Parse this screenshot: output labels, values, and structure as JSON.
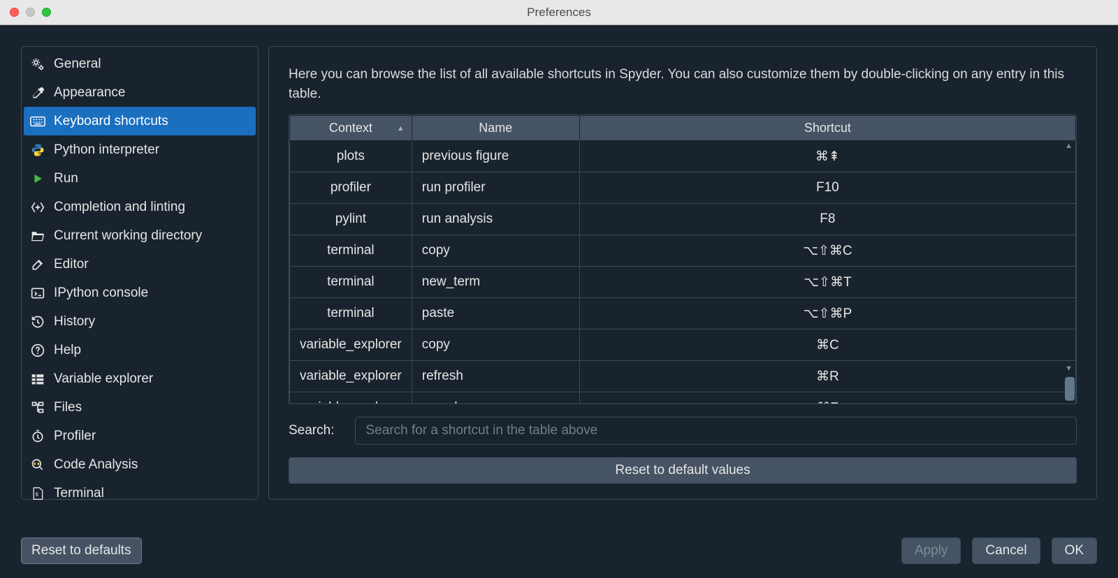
{
  "window": {
    "title": "Preferences"
  },
  "sidebar": {
    "items": [
      {
        "label": "General"
      },
      {
        "label": "Appearance"
      },
      {
        "label": "Keyboard shortcuts"
      },
      {
        "label": "Python interpreter"
      },
      {
        "label": "Run"
      },
      {
        "label": "Completion and linting"
      },
      {
        "label": "Current working directory"
      },
      {
        "label": "Editor"
      },
      {
        "label": "IPython console"
      },
      {
        "label": "History"
      },
      {
        "label": "Help"
      },
      {
        "label": "Variable explorer"
      },
      {
        "label": "Files"
      },
      {
        "label": "Profiler"
      },
      {
        "label": "Code Analysis"
      },
      {
        "label": "Terminal"
      }
    ],
    "selected_index": 2
  },
  "content": {
    "intro": "Here you can browse the list of all available shortcuts in Spyder. You can also customize them by double-clicking on any entry in this table.",
    "columns": {
      "context": "Context",
      "name": "Name",
      "shortcut": "Shortcut"
    },
    "sort_column": "context",
    "sort_dir": "asc",
    "rows": [
      {
        "context": "plots",
        "name": "previous figure",
        "shortcut": "⌘⇞"
      },
      {
        "context": "profiler",
        "name": "run profiler",
        "shortcut": "F10"
      },
      {
        "context": "pylint",
        "name": "run analysis",
        "shortcut": "F8"
      },
      {
        "context": "terminal",
        "name": "copy",
        "shortcut": "⌥⇧⌘C"
      },
      {
        "context": "terminal",
        "name": "new_term",
        "shortcut": "⌥⇧⌘T"
      },
      {
        "context": "terminal",
        "name": "paste",
        "shortcut": "⌥⇧⌘P"
      },
      {
        "context": "variable_explorer",
        "name": "copy",
        "shortcut": "⌘C"
      },
      {
        "context": "variable_explorer",
        "name": "refresh",
        "shortcut": "⌘R"
      },
      {
        "context": "variable_explorer",
        "name": "search",
        "shortcut": "⌘F"
      }
    ],
    "search": {
      "label": "Search:",
      "placeholder": "Search for a shortcut in the table above"
    },
    "reset_label": "Reset to default values"
  },
  "bottom": {
    "reset_defaults": "Reset to defaults",
    "apply": "Apply",
    "cancel": "Cancel",
    "ok": "OK"
  }
}
